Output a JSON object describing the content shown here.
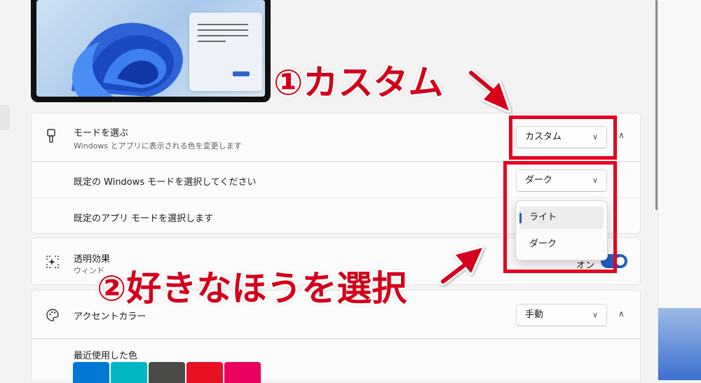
{
  "mode_section": {
    "title": "モードを選ぶ",
    "subtitle": "Windows とアプリに表示される色を変更します",
    "dropdown_value": "カスタム",
    "windows_mode_label": "既定の Windows モードを選択してください",
    "windows_mode_value": "ダーク",
    "app_mode_label": "既定のアプリ モードを選択します",
    "app_mode_options": [
      "ライト",
      "ダーク"
    ],
    "app_mode_selected": "ライト"
  },
  "transparency": {
    "title": "透明効果",
    "subtitle": "ウィンド",
    "toggle_label": "オン",
    "toggle_on": true
  },
  "accent": {
    "title": "アクセントカラー",
    "dropdown_value": "手動",
    "recent_label": "最近使用した色",
    "recent_colors": [
      "#0078d4",
      "#00b7c3",
      "#4c4a48",
      "#e81123",
      "#ea005e"
    ]
  },
  "annotations": {
    "step1": "①カスタム",
    "step2": "②好きなほうを選択"
  },
  "icons": {
    "mode": "brush-icon",
    "transparency": "sparkle-select-icon",
    "accent": "palette-icon",
    "chevron": "chevron-down-icon",
    "collapse": "chevron-up-icon"
  },
  "colors": {
    "accent_blue": "#1f5fbf",
    "annotation_red": "#e8001f"
  }
}
